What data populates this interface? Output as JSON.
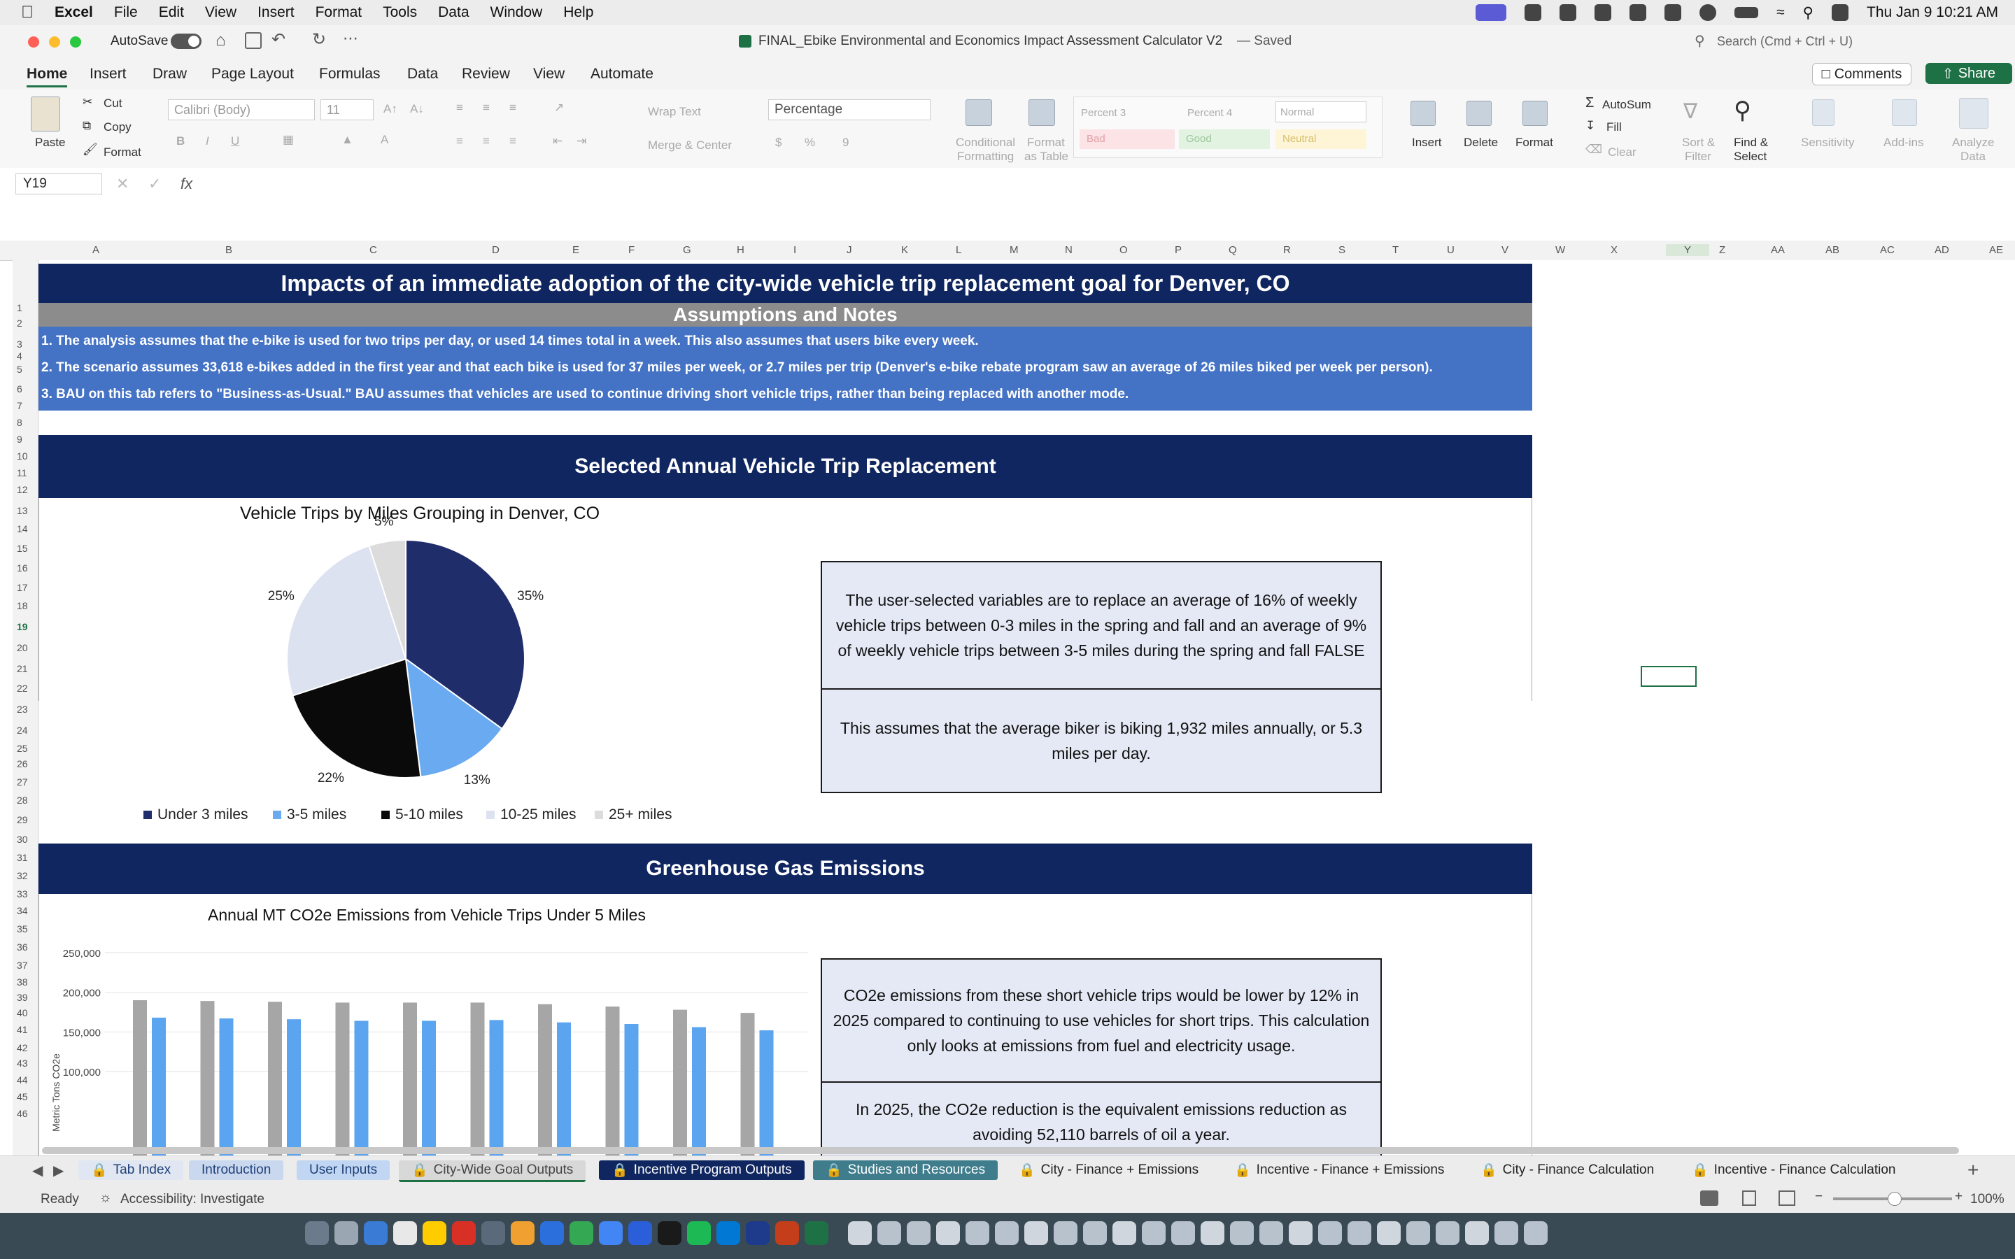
{
  "menubar": {
    "app": "Excel",
    "items": [
      "File",
      "Edit",
      "View",
      "Insert",
      "Format",
      "Tools",
      "Data",
      "Window",
      "Help"
    ],
    "clock": "Thu Jan 9  10:21 AM"
  },
  "window": {
    "autosave_label": "AutoSave",
    "doc_title": "FINAL_Ebike Environmental and Economics Impact Assessment Calculator V2",
    "doc_status": "— Saved",
    "search_placeholder": "Search (Cmd + Ctrl + U)"
  },
  "ribbon": {
    "tabs": [
      "Home",
      "Insert",
      "Draw",
      "Page Layout",
      "Formulas",
      "Data",
      "Review",
      "View",
      "Automate"
    ],
    "comments_label": "Comments",
    "share_label": "Share",
    "paste_label": "Paste",
    "cut_label": "Cut",
    "copy_label": "Copy",
    "format_painter_label": "Format",
    "font_name": "Calibri (Body)",
    "font_size": "11",
    "wrap_text_label": "Wrap Text",
    "merge_label": "Merge & Center",
    "number_format": "Percentage",
    "conditional_label": "Conditional",
    "conditional_label2": "Formatting",
    "format_table_label": "Format",
    "format_table_label2": "as Table",
    "styles": [
      "Percent 3",
      "Percent 4",
      "Normal",
      "Bad",
      "Good",
      "Neutral"
    ],
    "insert_label": "Insert",
    "delete_label": "Delete",
    "format_label": "Format",
    "autosum_label": "AutoSum",
    "fill_label": "Fill",
    "clear_label": "Clear",
    "sort_label": "Sort &",
    "sort_label2": "Filter",
    "find_label": "Find &",
    "find_label2": "Select",
    "sensitivity_label": "Sensitivity",
    "addins_label": "Add-ins",
    "analyze_label": "Analyze",
    "analyze_label2": "Data"
  },
  "formula_bar": {
    "cell_ref": "Y19",
    "fx": "fx",
    "value": ""
  },
  "columns": [
    "A",
    "B",
    "C",
    "D",
    "E",
    "F",
    "G",
    "H",
    "I",
    "J",
    "K",
    "L",
    "M",
    "N",
    "O",
    "P",
    "Q",
    "R",
    "S",
    "T",
    "U",
    "V",
    "W",
    "X",
    "Y",
    "Z",
    "AA",
    "AB",
    "AC",
    "AD",
    "AE"
  ],
  "rows": [
    "1",
    "2",
    "3",
    "4",
    "5",
    "6",
    "7",
    "8",
    "9",
    "10",
    "11",
    "12",
    "13",
    "14",
    "15",
    "16",
    "17",
    "18",
    "19",
    "20",
    "21",
    "22",
    "23",
    "24",
    "25",
    "26",
    "27",
    "28",
    "29",
    "30",
    "31",
    "32",
    "33",
    "34",
    "35",
    "36",
    "37",
    "38",
    "39",
    "40",
    "41",
    "42",
    "43",
    "44",
    "45",
    "46"
  ],
  "sheet": {
    "main_title": "Impacts of an immediate adoption of the city-wide vehicle trip replacement goal for Denver, CO",
    "assumptions_title": "Assumptions and Notes",
    "notes": [
      "1. The analysis assumes that the e-bike is used for two trips per day, or used 14 times total in a week. This also assumes that users bike every week.",
      "2. The scenario assumes 33,618 e-bikes added in the first year and that each bike is used for 37 miles per week, or 2.7 miles per trip (Denver's e-bike rebate program saw an average of 26 miles biked per week per person).",
      "3. BAU on this tab refers to \"Business-as-Usual.\" BAU assumes that vehicles are used to continue driving short vehicle trips, rather than being replaced with another mode."
    ],
    "section1_title": "Selected Annual Vehicle Trip Replacement",
    "textbox1": "The user-selected variables are to replace an average of 16% of weekly vehicle trips between 0-3 miles in the spring and fall and an average of 9% of weekly vehicle trips between 3-5 miles during the spring and fall FALSE",
    "textbox2": "This assumes that the average biker is biking 1,932 miles annually, or 5.3 miles per day.",
    "section2_title": "Greenhouse Gas Emissions",
    "textbox3": "CO2e emissions from these short vehicle trips would be lower by 12% in 2025 compared to continuing to use vehicles for short trips. This calculation only looks at emissions from fuel and electricity usage.",
    "textbox4": "In 2025, the CO2e reduction is the equivalent emissions reduction as avoiding 52,110 barrels of oil a year."
  },
  "chart_data": [
    {
      "type": "pie",
      "title": "Vehicle Trips by Miles Grouping in Denver, CO",
      "categories": [
        "Under 3 miles",
        "3-5 miles",
        "5-10 miles",
        "10-25 miles",
        "25+ miles"
      ],
      "values": [
        35,
        13,
        22,
        25,
        5
      ],
      "labels": [
        "35%",
        "13%",
        "22%",
        "25%",
        "5%"
      ],
      "colors": [
        "#1f2d6b",
        "#6aaaf0",
        "#0a0a0a",
        "#dde2f0",
        "#dcdcdc"
      ],
      "legend": "bottom"
    },
    {
      "type": "bar",
      "title": "Annual MT CO2e Emissions from Vehicle Trips Under 5 Miles",
      "ylabel": "Metric Tons CO2e",
      "ylim": [
        100000,
        250000
      ],
      "yticks": [
        "250,000",
        "200,000",
        "150,000",
        "100,000"
      ],
      "ytick_values": [
        250000,
        200000,
        150000,
        100000
      ],
      "series": [
        {
          "color": "#a6a6a6",
          "values": [
            190000,
            189000,
            188000,
            187000,
            187000,
            187000,
            185000,
            182000,
            178000,
            174000
          ]
        },
        {
          "color": "#5aa4f0",
          "values": [
            168000,
            167000,
            166000,
            164000,
            164000,
            165000,
            162000,
            160000,
            156000,
            152000
          ]
        }
      ]
    }
  ],
  "sheet_tabs": [
    "Tab Index",
    "Introduction",
    "User Inputs",
    "City-Wide Goal Outputs",
    "Incentive Program Outputs",
    "Studies and Resources",
    "City - Finance + Emissions",
    "Incentive - Finance + Emissions",
    "City - Finance Calculation",
    "Incentive - Finance Calculation"
  ],
  "status": {
    "ready": "Ready",
    "accessibility": "Accessibility: Investigate",
    "zoom": "100%"
  },
  "colors": {
    "navy": "#102660",
    "blue_band": "#4472c4",
    "gray_band": "#8c8c8c",
    "excel_green": "#1e7145"
  }
}
